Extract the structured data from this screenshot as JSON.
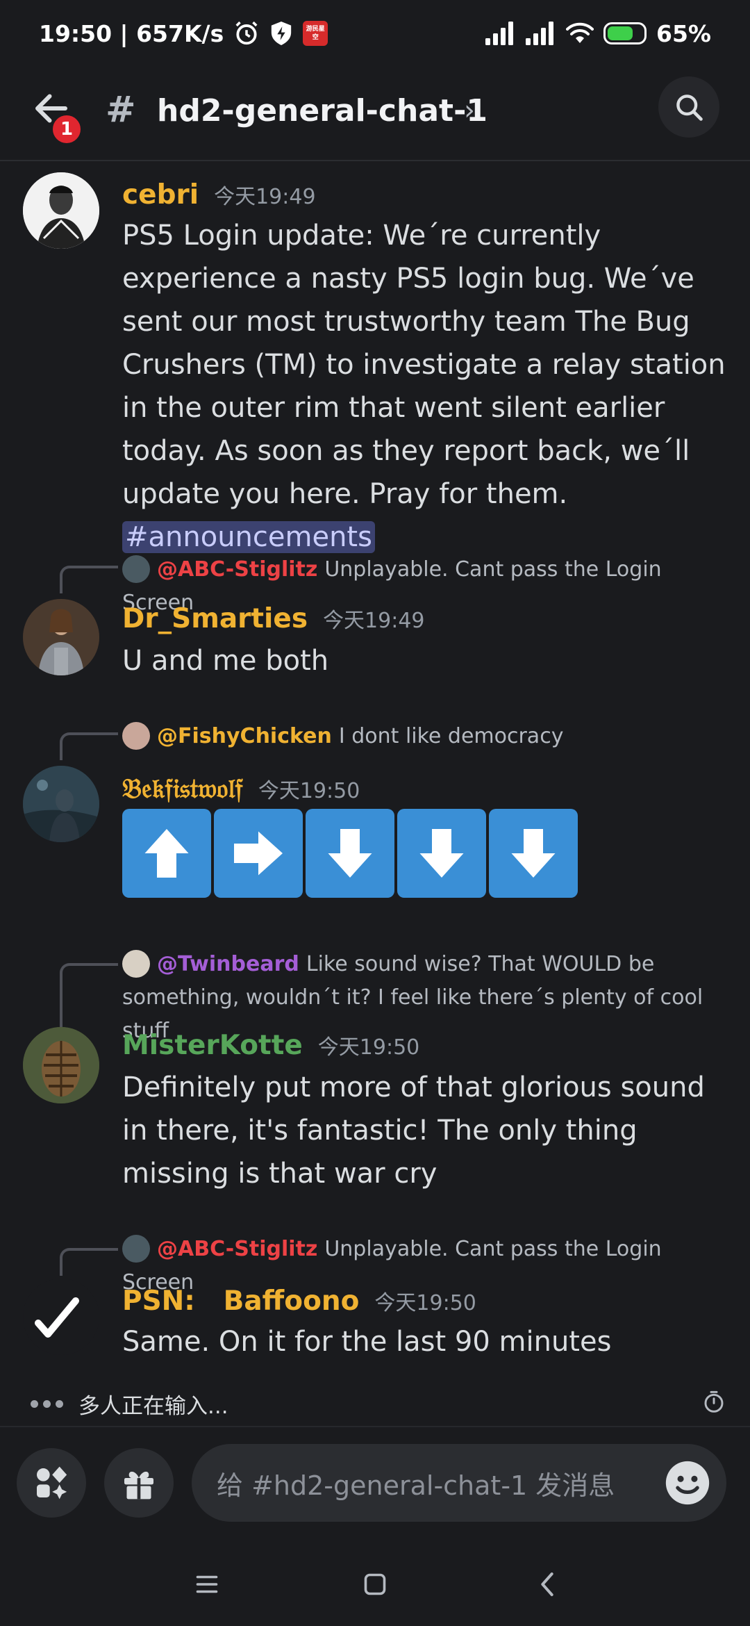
{
  "status_bar": {
    "time_speed": "19:50 | 657K/s",
    "battery": "65%",
    "app_badge_text": "游民星空"
  },
  "header": {
    "notification_count": "1",
    "channel_name": "hd2-general-chat-1",
    "hash": "#",
    "chevron": "›"
  },
  "messages": [
    {
      "author": "cebri",
      "author_color": "#f0b232",
      "timestamp": "今天19:49",
      "text": "PS5 Login update: We´re currently experience a nasty PS5 login bug. We´ve sent our most trustworthy team The Bug Crushers (TM) to investigate a relay station in the outer rim that went silent earlier today. As soon as they report back, we´ll update you here. Pray for them.",
      "channel_mention": "#announcements"
    },
    {
      "reply_to": "@ABC-Stiglitz",
      "reply_color": "#ed4245",
      "reply_text": "Unplayable. Cant pass the Login Screen",
      "author": "Dr_Smarties",
      "author_color": "#f0b232",
      "timestamp": "今天19:49",
      "text": "U and me both"
    },
    {
      "reply_to": "@FishyChicken",
      "reply_color": "#f0b232",
      "reply_text": "I dont like democracy",
      "author": "𝔅𝔢𝔨𝔣𝔦𝔰𝔱𝔴𝔬𝔩𝔣",
      "author_color": "#f0b232",
      "timestamp": "今天19:50",
      "arrows": [
        "up",
        "right",
        "down",
        "down",
        "down"
      ]
    },
    {
      "reply_to": "@Twinbeard",
      "reply_color": "#a45ed6",
      "reply_text": "Like sound wise? That WOULD be something, wouldn´t it? I feel like there´s plenty of cool stuff",
      "author": "MisterKotte",
      "author_color": "#57a65a",
      "timestamp": "今天19:50",
      "text": "Definitely put more of that glorious sound in there, it's fantastic! The only thing missing is that war cry"
    },
    {
      "reply_to": "@ABC-Stiglitz",
      "reply_color": "#ed4245",
      "reply_text": "Unplayable. Cant pass the Login Screen",
      "author": "PSN:   Baffoono",
      "author_color": "#f0b232",
      "timestamp": "今天19:50",
      "text": "Same. On it for the last 90 minutes"
    }
  ],
  "typing_indicator": "多人正在输入...",
  "composer": {
    "placeholder": "给 #hd2-general-chat-1 发消息"
  }
}
